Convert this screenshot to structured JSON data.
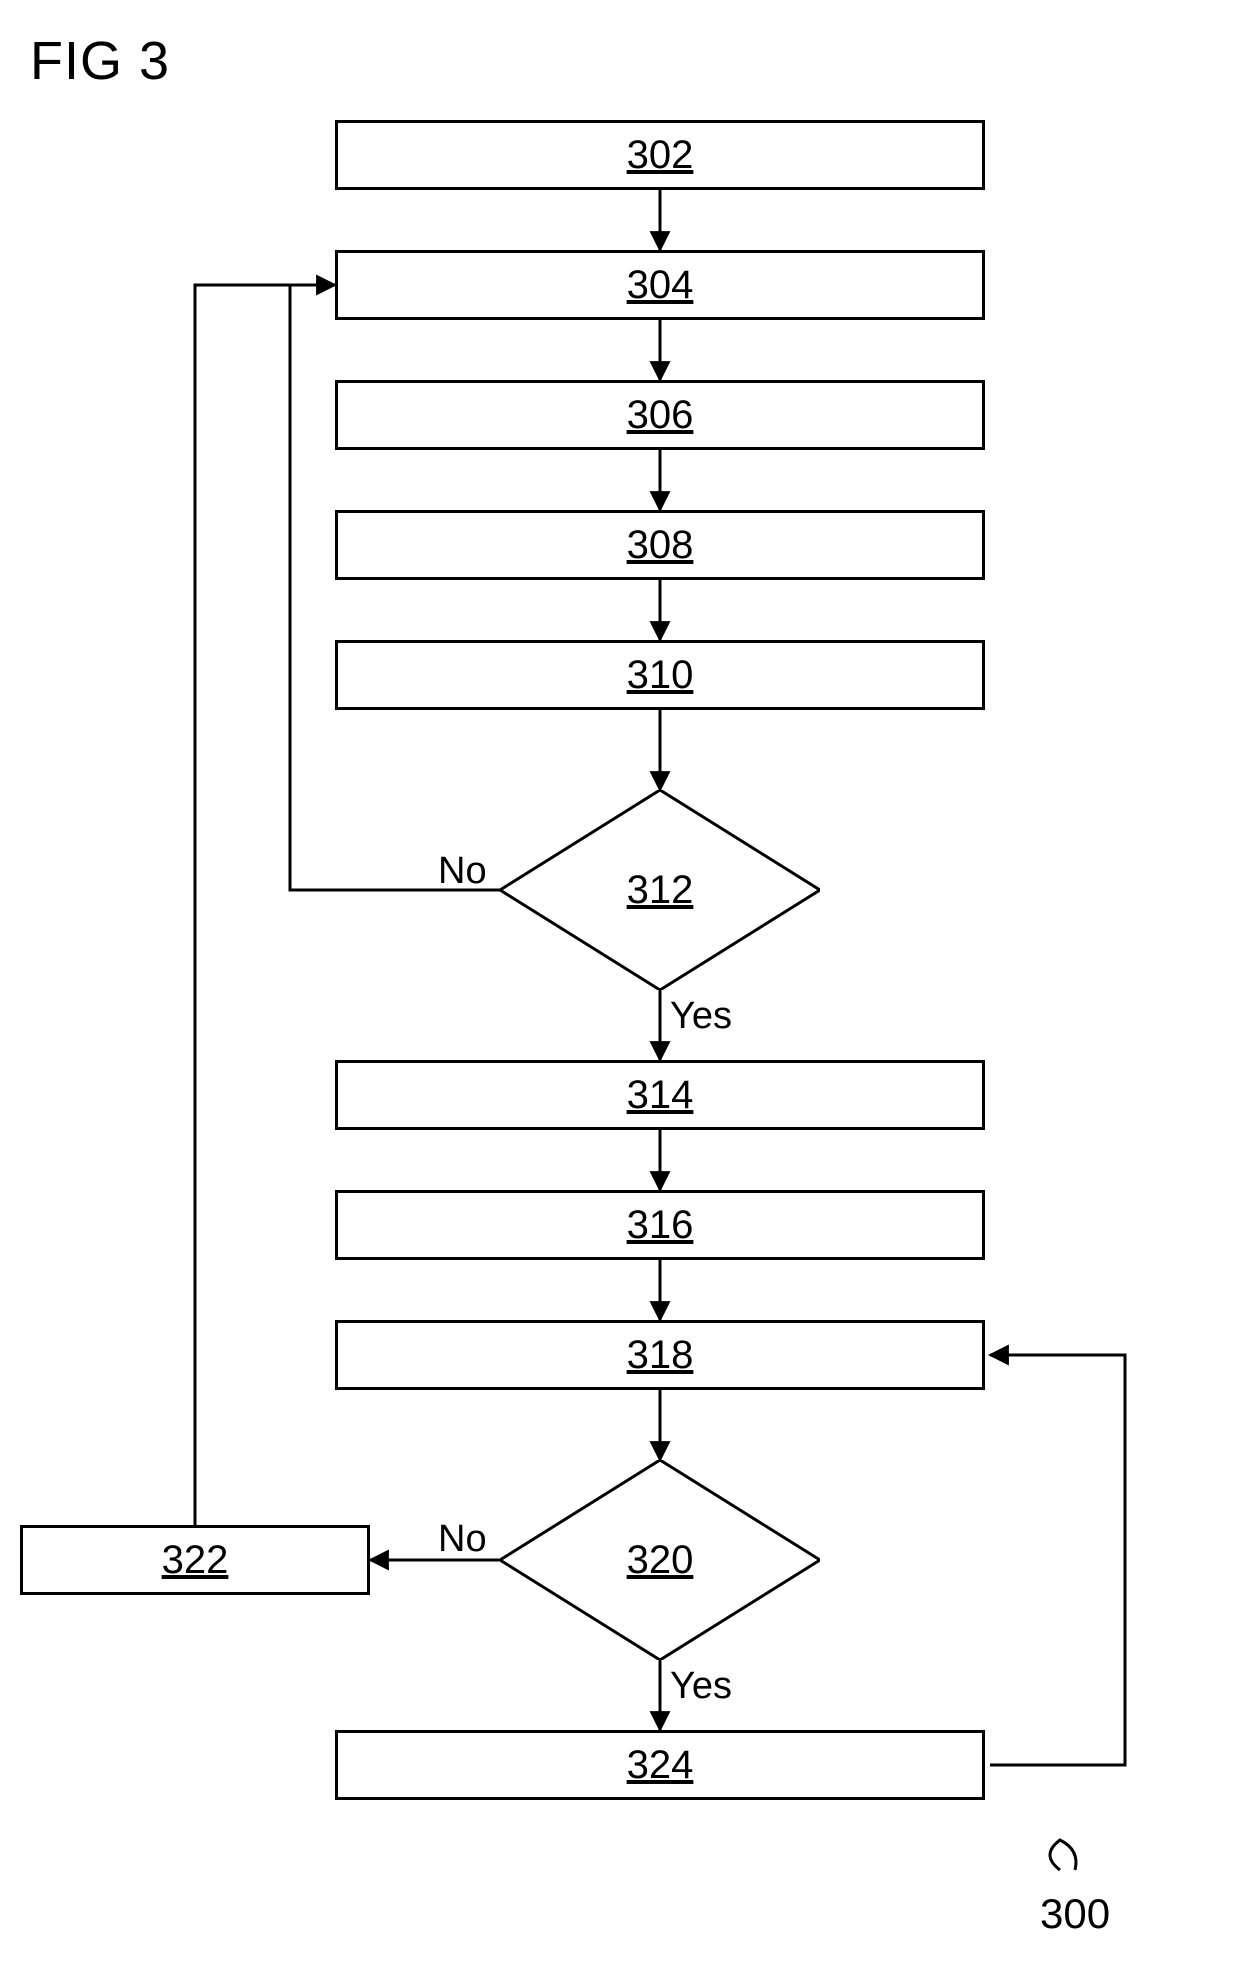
{
  "figure_label": "FIG 3",
  "reference_number": "300",
  "nodes": {
    "n302": "302",
    "n304": "304",
    "n306": "306",
    "n308": "308",
    "n310": "310",
    "n312": "312",
    "n314": "314",
    "n316": "316",
    "n318": "318",
    "n320": "320",
    "n322": "322",
    "n324": "324"
  },
  "edges": {
    "d312_no": "No",
    "d312_yes": "Yes",
    "d320_no": "No",
    "d320_yes": "Yes"
  }
}
